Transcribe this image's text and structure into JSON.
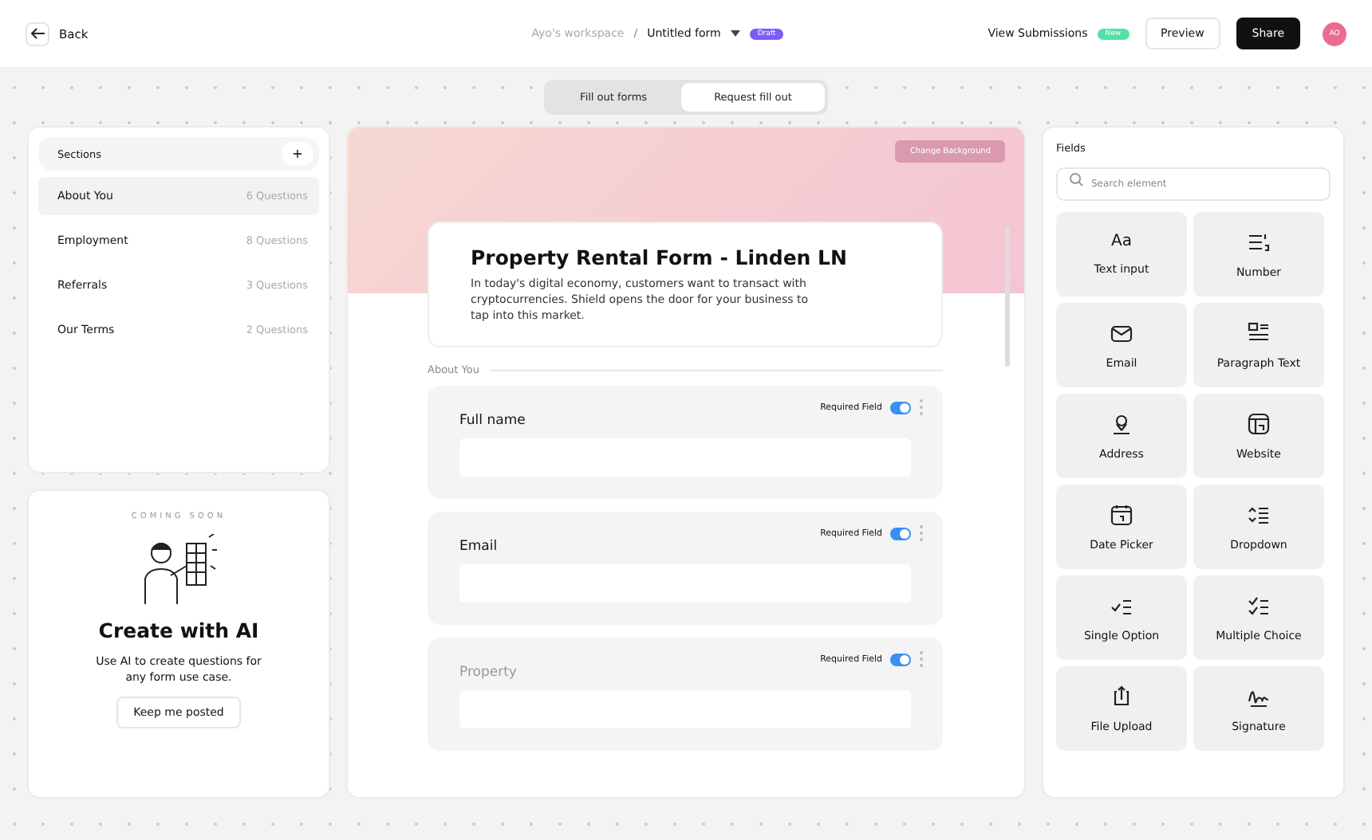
{
  "topbar": {
    "back": "Back",
    "workspace": "Ayo's workspace",
    "separator": "/",
    "form_name": "Untitled form",
    "form_badge": "Draft",
    "view_submissions": "View Submissions",
    "submissions_badge": "New",
    "preview": "Preview",
    "share": "Share",
    "avatar": "AO"
  },
  "mode_tabs": [
    {
      "label": "Fill out forms",
      "selected": false
    },
    {
      "label": "Request fill out",
      "selected": true
    }
  ],
  "sections": {
    "title": "Sections",
    "add": "+",
    "items": [
      {
        "name": "About You",
        "count": "6 Questions",
        "selected": true
      },
      {
        "name": "Employment",
        "count": "8 Questions",
        "selected": false
      },
      {
        "name": "Referrals",
        "count": "3 Questions",
        "selected": false
      },
      {
        "name": "Our Terms",
        "count": "2 Questions",
        "selected": false
      }
    ]
  },
  "ai_card": {
    "eyebrow": "COMING SOON",
    "title": "Create with AI",
    "text": "Use AI to create questions for any form use case.",
    "button": "Keep me posted"
  },
  "form": {
    "change_background": "Change Background",
    "title": "Property Rental Form - Linden LN",
    "description": "In today's digital economy, customers want to transact with cryptocurrencies. Shield opens the door for your business to tap into this market.",
    "section": "About You",
    "questions": [
      {
        "label": "Full name",
        "required_label": "Required Field",
        "required": true,
        "faded": false
      },
      {
        "label": "Email",
        "required_label": "Required Field",
        "required": true,
        "faded": false
      },
      {
        "label": "Property",
        "required_label": "Required Field",
        "required": true,
        "faded": true
      }
    ]
  },
  "fields": {
    "title": "Fields",
    "search_placeholder": "Search element",
    "items": [
      {
        "label": "Text input",
        "kind": "text",
        "glyph": "Aa"
      },
      {
        "label": "Number",
        "kind": "number"
      },
      {
        "label": "Email",
        "kind": "email"
      },
      {
        "label": "Paragraph Text",
        "kind": "paragraph"
      },
      {
        "label": "Address",
        "kind": "address"
      },
      {
        "label": "Website",
        "kind": "website"
      },
      {
        "label": "Date Picker",
        "kind": "date"
      },
      {
        "label": "Dropdown",
        "kind": "dropdown"
      },
      {
        "label": "Single Option",
        "kind": "single"
      },
      {
        "label": "Multiple Choice",
        "kind": "multiple"
      },
      {
        "label": "File Upload",
        "kind": "upload"
      },
      {
        "label": "Signature",
        "kind": "signature"
      }
    ]
  }
}
